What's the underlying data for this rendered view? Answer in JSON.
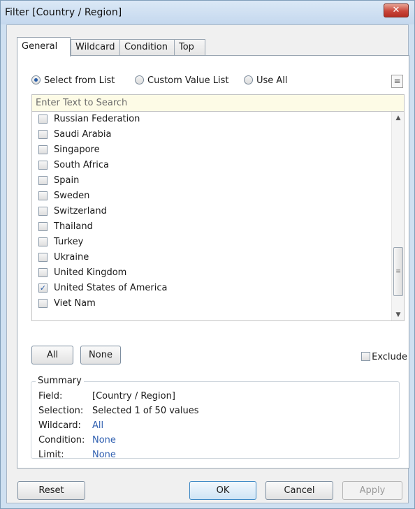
{
  "window": {
    "title": "Filter [Country / Region]",
    "close_glyph": "✕"
  },
  "tabs": [
    {
      "label": "General",
      "active": true
    },
    {
      "label": "Wildcard",
      "active": false
    },
    {
      "label": "Condition",
      "active": false
    },
    {
      "label": "Top",
      "active": false
    }
  ],
  "mode": {
    "options": [
      {
        "label": "Select from List",
        "checked": true
      },
      {
        "label": "Custom Value List",
        "checked": false
      },
      {
        "label": "Use All",
        "checked": false
      }
    ]
  },
  "search": {
    "placeholder": "Enter Text to Search",
    "value": ""
  },
  "list": {
    "items": [
      {
        "label": "Russian Federation",
        "checked": false
      },
      {
        "label": "Saudi Arabia",
        "checked": false
      },
      {
        "label": "Singapore",
        "checked": false
      },
      {
        "label": "South Africa",
        "checked": false
      },
      {
        "label": "Spain",
        "checked": false
      },
      {
        "label": "Sweden",
        "checked": false
      },
      {
        "label": "Switzerland",
        "checked": false
      },
      {
        "label": "Thailand",
        "checked": false
      },
      {
        "label": "Turkey",
        "checked": false
      },
      {
        "label": "Ukraine",
        "checked": false
      },
      {
        "label": "United Kingdom",
        "checked": false
      },
      {
        "label": "United States of America",
        "checked": true
      },
      {
        "label": "Viet Nam",
        "checked": false
      }
    ]
  },
  "buttons": {
    "all": "All",
    "none": "None",
    "exclude": "Exclude",
    "reset": "Reset",
    "ok": "OK",
    "cancel": "Cancel",
    "apply": "Apply"
  },
  "summary": {
    "title": "Summary",
    "rows": [
      {
        "label": "Field:",
        "value": "[Country / Region]",
        "link": false
      },
      {
        "label": "Selection:",
        "value": "Selected 1 of 50 values",
        "link": false
      },
      {
        "label": "Wildcard:",
        "value": "All",
        "link": true
      },
      {
        "label": "Condition:",
        "value": "None",
        "link": true
      },
      {
        "label": "Limit:",
        "value": "None",
        "link": true
      }
    ]
  },
  "icons": {
    "radio_dot": "radio-dot",
    "check_mark": "✓",
    "list_menu": "≡",
    "scroll_up": "▲",
    "scroll_down": "▼",
    "grip": "≡"
  },
  "colors": {
    "link": "#2f5fb0",
    "search_background": "#fdfbe6",
    "default_button_border": "#3b87c4"
  }
}
